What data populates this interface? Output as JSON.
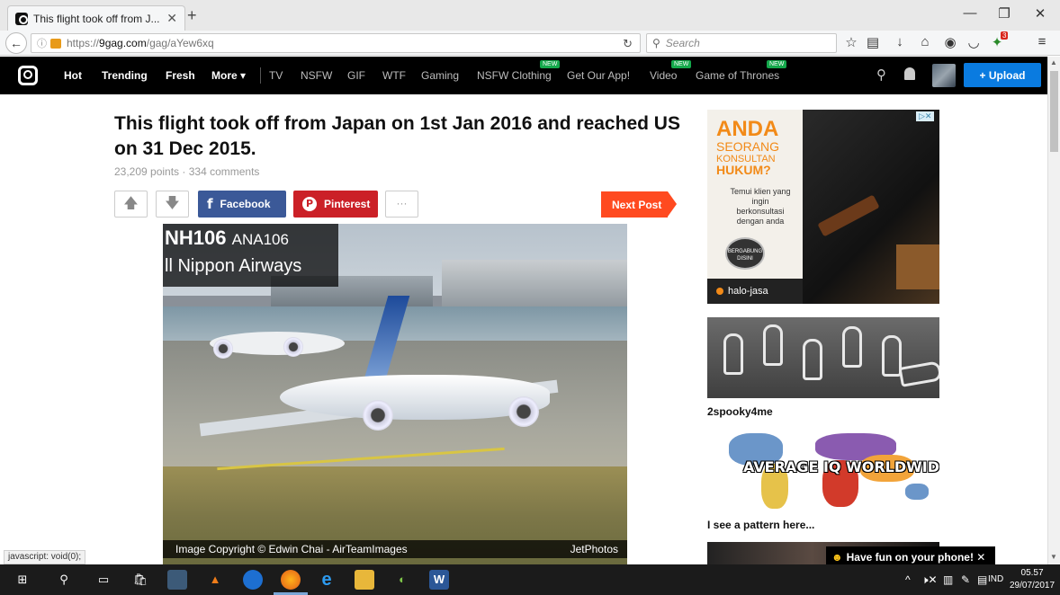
{
  "browser": {
    "tab_title": "This flight took off from J...",
    "url_proto": "https://",
    "url_host": "9gag.com",
    "url_path": "/gag/aYew6xq",
    "search_placeholder": "Search",
    "status_text": "javascript: void(0);",
    "notif_count": "3"
  },
  "site_nav": {
    "primary": [
      "Hot",
      "Trending",
      "Fresh",
      "More ▾"
    ],
    "secondary": [
      "TV",
      "NSFW",
      "GIF",
      "WTF",
      "Gaming",
      "NSFW Clothing",
      "Get Our App!",
      "Video",
      "Game of Thrones"
    ],
    "new_badge": "NEW",
    "upload_label": "+ Upload"
  },
  "post": {
    "title": "This flight took off from Japan on 1st Jan 2016 and reached US on 31 Dec 2015.",
    "meta": "23,209 points · 334 comments",
    "facebook_label": "Facebook",
    "pinterest_label": "Pinterest",
    "more_label": "···",
    "next_label": "Next Post",
    "image_caption_flight": "NH106",
    "image_caption_code": "ANA106",
    "image_caption_airline": "ll Nippon Airways",
    "image_credit": "Image Copyright © Edwin Chai - AirTeamImages",
    "image_source": "JetPhotos"
  },
  "sidebar": {
    "ad": {
      "line1": "ANDA",
      "line2": "SEORANG",
      "line3": "KONSULTAN",
      "line4": "HUKUM?",
      "body": "Temui klien yang ingin berkonsultasi dengan anda",
      "cta": "BERGABUNG DISINI",
      "brand": "halo-jasa",
      "choices": "▷✕"
    },
    "items": [
      {
        "label": "2spooky4me"
      },
      {
        "label": "I see a pattern here...",
        "image_text": "AVERAGE IQ WORLDWIDE"
      }
    ],
    "toast": "Have fun on your phone! ✕"
  },
  "taskbar": {
    "lang": "IND",
    "time": "05.57",
    "date": "29/07/2017"
  },
  "colors": {
    "nav_bg": "#000000",
    "upload_blue": "#0a7be0",
    "facebook": "#3b5998",
    "pinterest": "#cb2027",
    "next_post": "#ff4a20",
    "new_badge": "#14a84b",
    "ad_orange": "#f28a18"
  }
}
